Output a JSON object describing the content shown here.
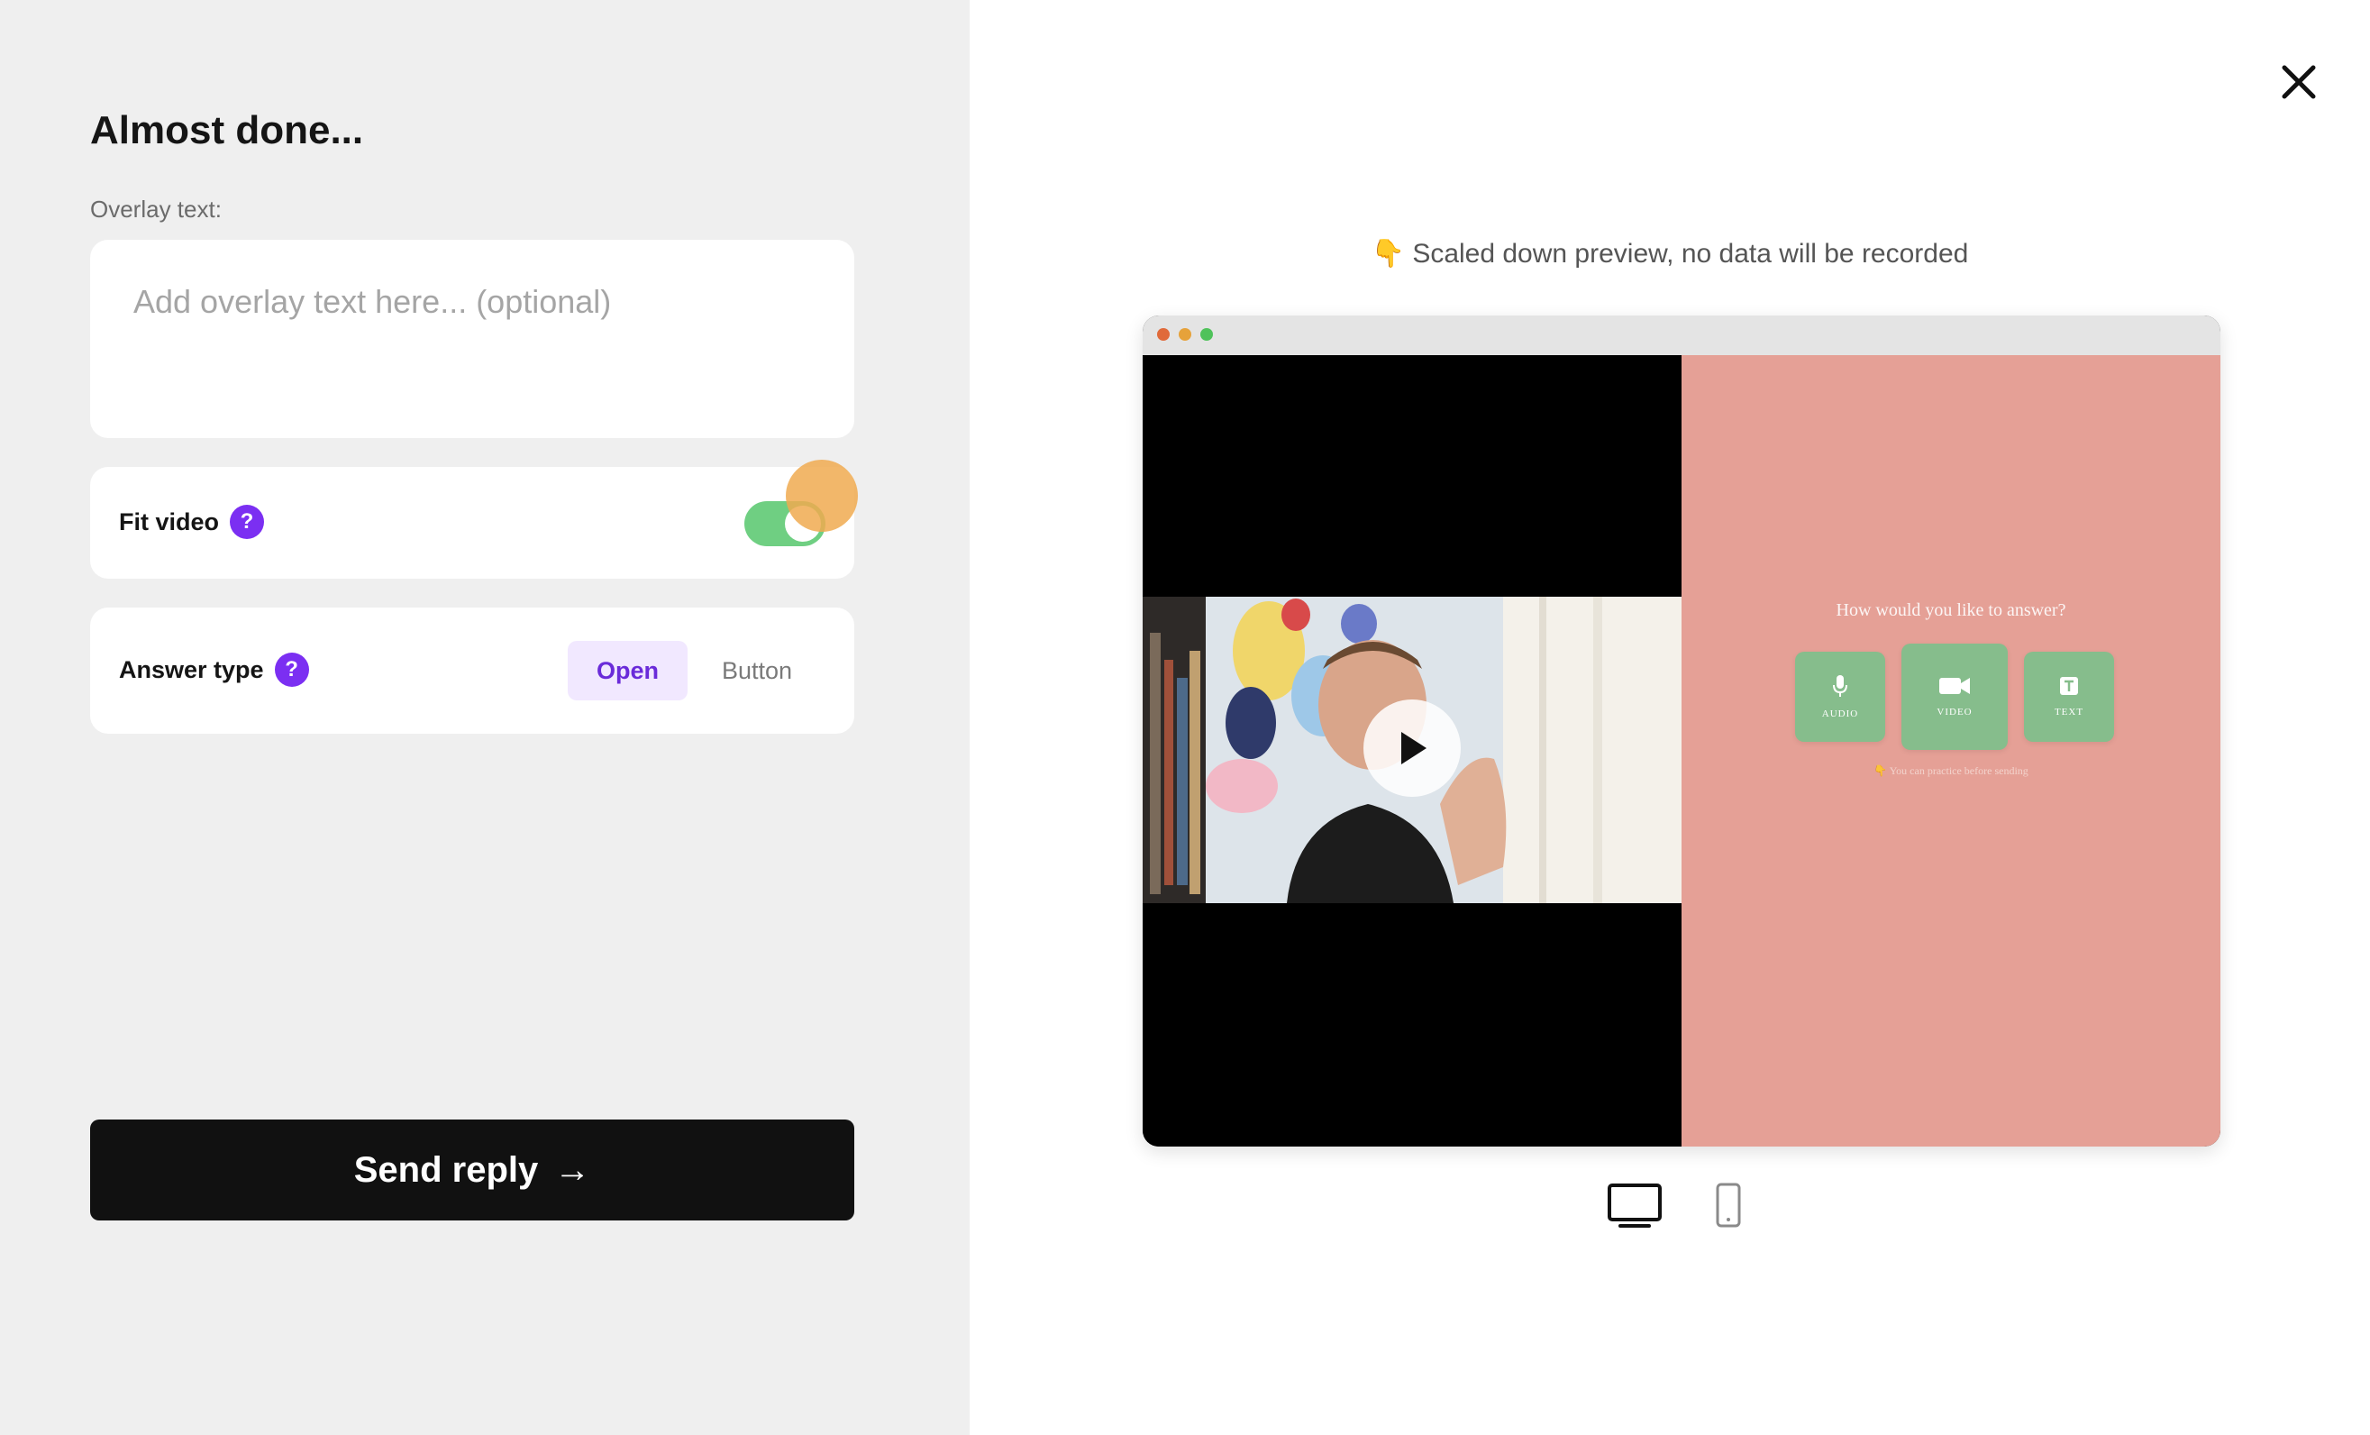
{
  "left_panel": {
    "title": "Almost done...",
    "overlay": {
      "label": "Overlay text:",
      "placeholder": "Add overlay text here... (optional)",
      "value": ""
    },
    "fit_video": {
      "label": "Fit video",
      "help_glyph": "?",
      "enabled": true
    },
    "answer_type": {
      "label": "Answer type",
      "help_glyph": "?",
      "options": [
        "Open",
        "Button"
      ],
      "selected": "Open"
    },
    "send_button": {
      "label": "Send reply",
      "arrow": "→"
    }
  },
  "right_panel": {
    "preview_note": "👇 Scaled down preview, no data will be recorded",
    "preview": {
      "question": "How would you like to answer?",
      "choices": [
        {
          "label": "AUDIO",
          "icon": "microphone-icon"
        },
        {
          "label": "VIDEO",
          "icon": "video-camera-icon"
        },
        {
          "label": "TEXT",
          "icon": "text-icon"
        }
      ],
      "hint": "👇 You can practice before sending",
      "background_color": "#e5a096",
      "choice_color": "#86bd8c"
    },
    "devices": [
      "desktop",
      "mobile"
    ],
    "selected_device": "desktop"
  },
  "colors": {
    "accent": "#7b2ff2",
    "toggle_on": "#6fcf82",
    "button_bg": "#111111"
  }
}
